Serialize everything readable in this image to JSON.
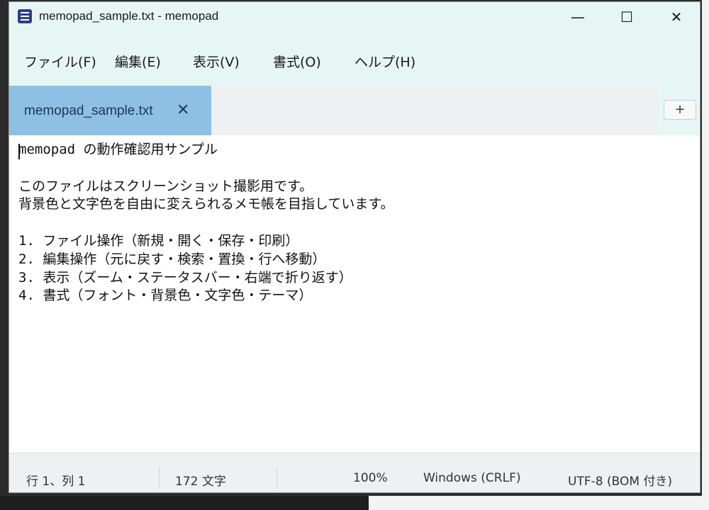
{
  "window": {
    "title": "memopad_sample.txt - memopad",
    "app_icon": "notepad-icon",
    "controls": {
      "minimize": "—",
      "maximize": "☐",
      "close": "✕"
    }
  },
  "menu": [
    {
      "label": "ファイル(F)"
    },
    {
      "label": "編集(E)"
    },
    {
      "label": "表示(V)"
    },
    {
      "label": "書式(O)"
    },
    {
      "label": "ヘルプ(H)"
    }
  ],
  "tabs": [
    {
      "label": "memopad_sample.txt",
      "close": "✕",
      "active": true
    }
  ],
  "new_tab_label": "+",
  "editor": {
    "content": "memopad の動作確認用サンプル\n\nこのファイルはスクリーンショット撮影用です。\n背景色と文字色を自由に変えられるメモ帳を目指しています。\n\n1. ファイル操作（新規・開く・保存・印刷）\n2. 編集操作（元に戻す・検索・置換・行へ移動）\n3. 表示（ズーム・ステータスバー・右端で折り返す）\n4. 書式（フォント・背景色・文字色・テーマ）"
  },
  "status": {
    "position": "行 1、列 1",
    "char_count": "172 文字",
    "zoom": "100%",
    "line_ending": "Windows (CRLF)",
    "encoding": "UTF-8 (BOM 付き)"
  },
  "colors": {
    "titlebar": "#e6f6f4",
    "active_tab": "#8ebfe4",
    "tabbar": "#eef0f2",
    "editor_bg": "#ffffff"
  }
}
